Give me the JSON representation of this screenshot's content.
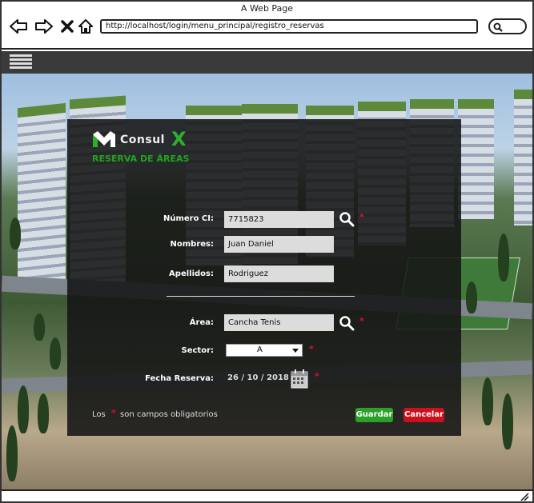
{
  "browser": {
    "title": "A Web Page",
    "url": "http://localhost/login/menu_principal/registro_reservas"
  },
  "brand": {
    "logo_text": "Consul",
    "logo_x": "X",
    "subtitle": "RESERVA DE ÁREAS"
  },
  "form": {
    "ci_label": "Número CI:",
    "ci_value": "7715823",
    "nombres_label": "Nombres:",
    "nombres_value": "Juan Daniel",
    "apellidos_label": "Apellidos:",
    "apellidos_value": "Rodriguez",
    "area_label": "Área:",
    "area_value": "Cancha Tenis",
    "sector_label": "Sector:",
    "sector_value": "A",
    "fecha_label": "Fecha Reserva:",
    "fecha_value": "26 / 10 / 2018",
    "required_mark": "*"
  },
  "footer": {
    "legend_prefix": "Los",
    "legend_suffix": "son campos obligatorios",
    "save_label": "Guardar",
    "cancel_label": "Cancelar"
  },
  "colors": {
    "accent_green": "#2aa02a",
    "cancel_red": "#c9101c",
    "required_red": "#e0102a",
    "panel_bg": "#141414"
  },
  "icons": [
    "back-arrow-icon",
    "forward-arrow-icon",
    "close-icon",
    "home-icon",
    "search-icon",
    "menu-icon",
    "magnifier-icon",
    "calendar-icon",
    "resize-grip-icon"
  ]
}
